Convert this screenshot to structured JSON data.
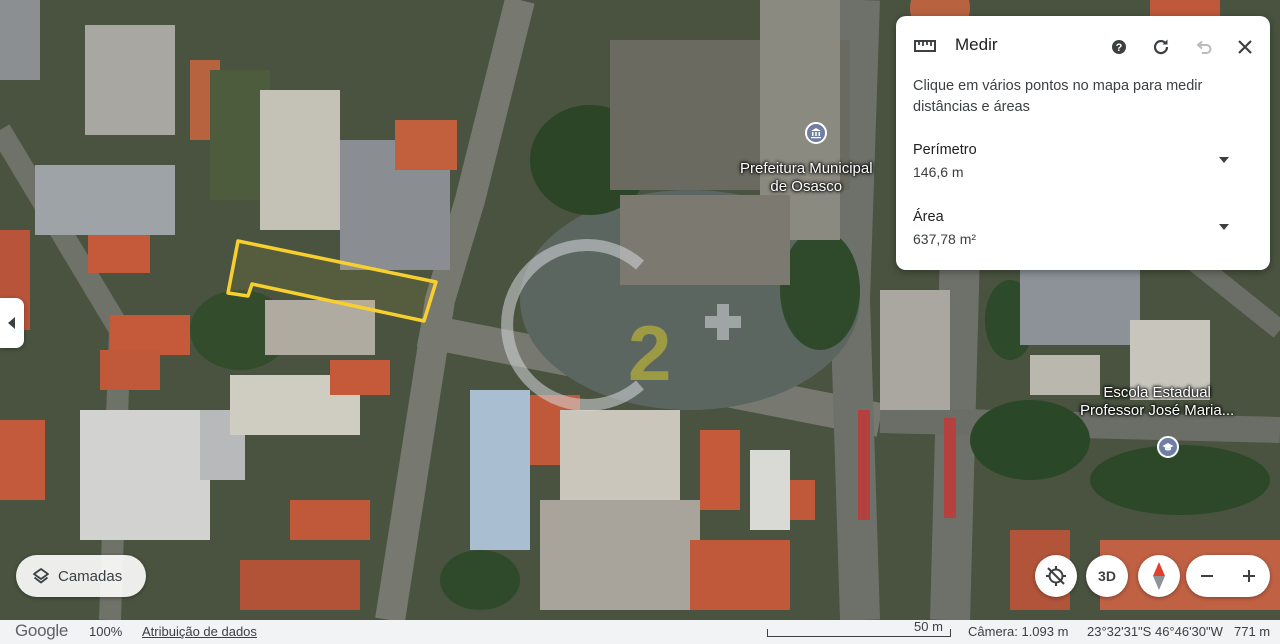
{
  "panel": {
    "title": "Medir",
    "description": "Clique em vários pontos no mapa para medir distâncias e áreas",
    "perimeter_label": "Perímetro",
    "perimeter_value": "146,6 m",
    "area_label": "Área",
    "area_value": "637,78 m²",
    "icons": [
      "ruler-icon",
      "help-icon",
      "refresh-icon",
      "undo-icon",
      "close-icon"
    ]
  },
  "map": {
    "labels": [
      {
        "id": "prefeitura",
        "text": "Prefeitura Municipal\nde Osasco"
      },
      {
        "id": "escola",
        "text": "Escola Estadual\nProfessor José Maria..."
      }
    ],
    "measure_color": "#f7d02f",
    "watermark": "C2+"
  },
  "controls": {
    "layers_label": "Camadas",
    "btn_3d": "3D"
  },
  "bottom_bar": {
    "logo": "Google",
    "zoom": "100%",
    "attribution": "Atribuição de dados",
    "scale": "50 m",
    "camera": "Câmera: 1.093 m",
    "coordinates": "23°32'31\"S 46°46'30\"W",
    "altitude": "771 m"
  }
}
